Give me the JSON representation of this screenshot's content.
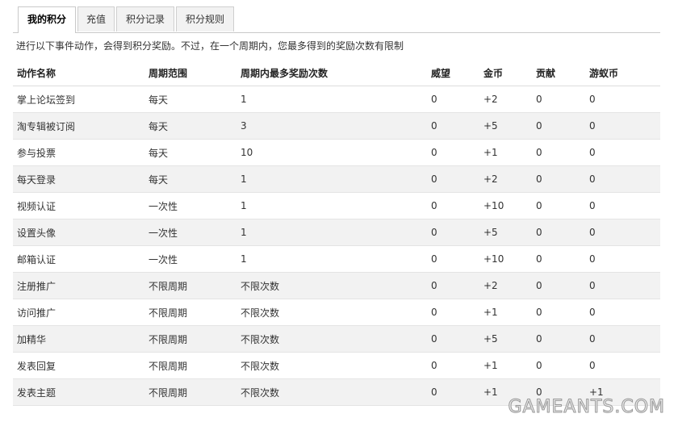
{
  "tabs": [
    {
      "label": "我的积分",
      "active": true
    },
    {
      "label": "充值",
      "active": false
    },
    {
      "label": "积分记录",
      "active": false
    },
    {
      "label": "积分规则",
      "active": false
    }
  ],
  "notice": "进行以下事件动作，会得到积分奖励。不过，在一个周期内，您最多得到的奖励次数有限制",
  "table": {
    "headers": [
      "动作名称",
      "周期范围",
      "周期内最多奖励次数",
      "威望",
      "金币",
      "贡献",
      "游蚁币"
    ],
    "rows": [
      [
        "掌上论坛签到",
        "每天",
        "1",
        "0",
        "+2",
        "0",
        "0"
      ],
      [
        "淘专辑被订阅",
        "每天",
        "3",
        "0",
        "+5",
        "0",
        "0"
      ],
      [
        "参与投票",
        "每天",
        "10",
        "0",
        "+1",
        "0",
        "0"
      ],
      [
        "每天登录",
        "每天",
        "1",
        "0",
        "+2",
        "0",
        "0"
      ],
      [
        "视频认证",
        "一次性",
        "1",
        "0",
        "+10",
        "0",
        "0"
      ],
      [
        "设置头像",
        "一次性",
        "1",
        "0",
        "+5",
        "0",
        "0"
      ],
      [
        "邮箱认证",
        "一次性",
        "1",
        "0",
        "+10",
        "0",
        "0"
      ],
      [
        "注册推广",
        "不限周期",
        "不限次数",
        "0",
        "+2",
        "0",
        "0"
      ],
      [
        "访问推广",
        "不限周期",
        "不限次数",
        "0",
        "+1",
        "0",
        "0"
      ],
      [
        "加精华",
        "不限周期",
        "不限次数",
        "0",
        "+5",
        "0",
        "0"
      ],
      [
        "发表回复",
        "不限周期",
        "不限次数",
        "0",
        "+1",
        "0",
        "0"
      ],
      [
        "发表主题",
        "不限周期",
        "不限次数",
        "0",
        "+1",
        "0",
        "+1"
      ]
    ]
  },
  "watermark": "GAMEANTS.COM"
}
